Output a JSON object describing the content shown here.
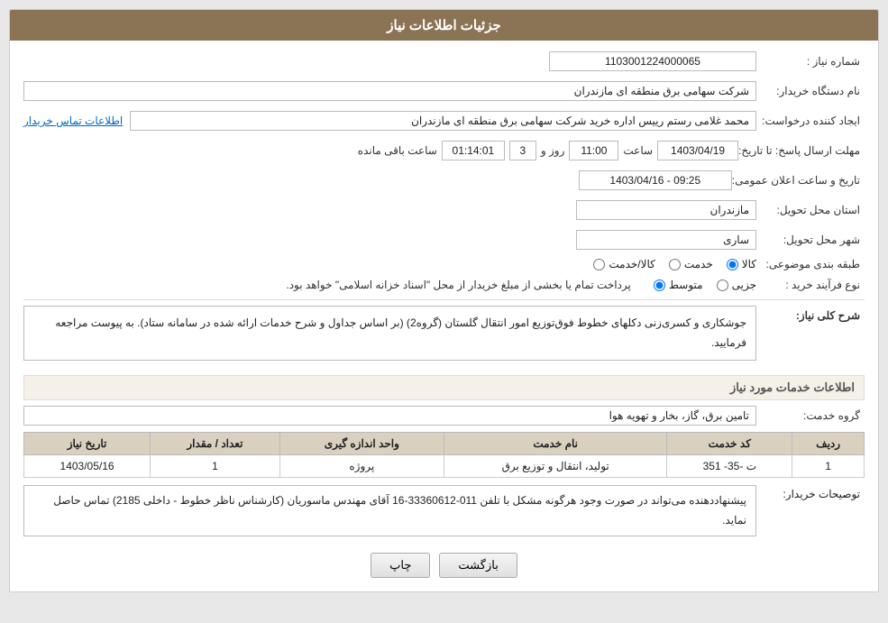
{
  "header": {
    "title": "جزئیات اطلاعات نیاز"
  },
  "fields": {
    "need_number_label": "شماره نیاز :",
    "need_number_value": "1103001224000065",
    "buyer_org_label": "نام دستگاه خریدار:",
    "buyer_org_value": "شرکت سهامی برق منطقه ای مازندران",
    "creator_label": "ایجاد کننده درخواست:",
    "creator_value": "محمد غلامی رستم رییس اداره خرید شرکت سهامی برق منطقه ای مازندران",
    "contact_link": "اطلاعات تماس خریدار",
    "deadline_label": "مهلت ارسال پاسخ: تا تاریخ:",
    "deadline_date": "1403/04/19",
    "deadline_time_label": "ساعت",
    "deadline_time": "11:00",
    "deadline_day_label": "روز و",
    "deadline_days": "3",
    "deadline_remaining_label": "ساعت باقی مانده",
    "deadline_remaining": "01:14:01",
    "announce_label": "تاریخ و ساعت اعلان عمومی:",
    "announce_value": "1403/04/16 - 09:25",
    "province_label": "استان محل تحویل:",
    "province_value": "مازندران",
    "city_label": "شهر محل تحویل:",
    "city_value": "ساری",
    "category_label": "طبقه بندی موضوعی:",
    "category_options": [
      {
        "label": "کالا",
        "value": "kala",
        "checked": true
      },
      {
        "label": "خدمت",
        "value": "khadamat",
        "checked": false
      },
      {
        "label": "کالا/خدمت",
        "value": "kala_khadamat",
        "checked": false
      }
    ],
    "purchase_type_label": "نوع فرآیند خرید :",
    "purchase_type_options": [
      {
        "label": "جزیی",
        "value": "jozi",
        "checked": false
      },
      {
        "label": "متوسط",
        "value": "motavaset",
        "checked": true
      }
    ],
    "payment_note": "پرداخت تمام یا بخشی از مبلغ خریدار از محل \"اسناد خزانه اسلامی\" خواهد بود.",
    "need_description_label": "شرح کلی نیاز:",
    "need_description": "جوشکاری و کسری‌زنی دکلهای خطوط فوق‌توزیع امور انتقال گلستان (گروه2) (بر اساس جداول و شرح خدمات ارائه شده در سامانه ستاد). به پیوست مراجعه فرمایید.",
    "services_title": "اطلاعات خدمات مورد نیاز",
    "service_group_label": "گروه خدمت:",
    "service_group_value": "تامین برق، گاز، بخار و تهویه هوا",
    "table": {
      "headers": [
        "ردیف",
        "کد خدمت",
        "نام خدمت",
        "واحد اندازه گیری",
        "تعداد / مقدار",
        "تاریخ نیاز"
      ],
      "rows": [
        {
          "row": "1",
          "code": "ت -35- 351",
          "name": "تولید، انتقال و توزیع برق",
          "unit": "پروژه",
          "qty": "1",
          "date": "1403/05/16"
        }
      ]
    },
    "buyer_notes_label": "توصیحات خریدار:",
    "buyer_notes": "پیشنهاددهنده می‌تواند در صورت وجود هرگونه مشکل با تلفن 011-33360612-16  آقای مهندس ماسوریان (کارشناس ناظر خطوط  - داخلی 2185) تماس حاصل نماید.",
    "buttons": {
      "back": "بازگشت",
      "print": "چاپ"
    }
  }
}
